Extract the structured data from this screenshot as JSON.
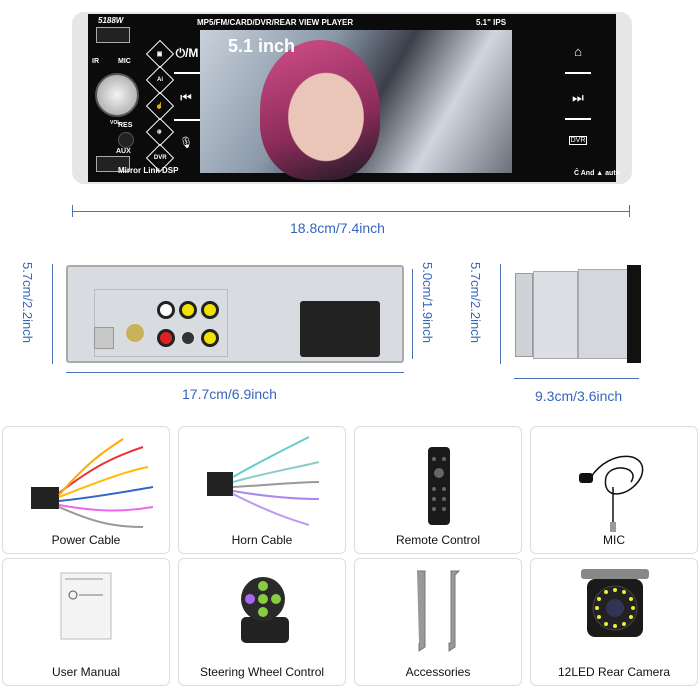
{
  "product_front": {
    "model": "5188W",
    "top_banner": "MP5/FM/CARD/DVR/REAR  VIEW  PLAYER",
    "screen_spec": "5.1\"  IPS",
    "screen_size_label": "5.1 inch",
    "power_mode_label": "⏻/M",
    "labels": {
      "ir": "IR",
      "mic": "MIC",
      "vol": "VOL",
      "res": "RES",
      "aux": "AUX"
    },
    "feature_icons": [
      "mirror-link-icon",
      "ai-icon",
      "touch-icon",
      "steering-wheel-icon",
      "DVR"
    ],
    "dvr_label": "DVR",
    "bottom_left": "Mirror Link  DSP",
    "bottom_right": "Ĉ And ▲ auto",
    "right_icons": [
      "home-icon",
      "call-next-icon",
      "dvr-icon"
    ]
  },
  "dimensions": {
    "front_width": "18.8cm/7.4inch",
    "back_height": "5.7cm/2.2inch",
    "back_inner_height": "5.0cm/1.9inch",
    "back_width": "17.7cm/6.9inch",
    "side_height": "5.7cm/2.2inch",
    "side_depth": "9.3cm/3.6inch"
  },
  "accessories": [
    {
      "label": "Power Cable"
    },
    {
      "label": "Horn Cable"
    },
    {
      "label": "Remote Control"
    },
    {
      "label": "MIC"
    },
    {
      "label": "User Manual"
    },
    {
      "label": "Steering Wheel Control"
    },
    {
      "label": "Accessories"
    },
    {
      "label": "12LED Rear Camera"
    }
  ],
  "colors": {
    "dimension_blue": "#3566bb",
    "unit_black": "#0b0b0b"
  }
}
